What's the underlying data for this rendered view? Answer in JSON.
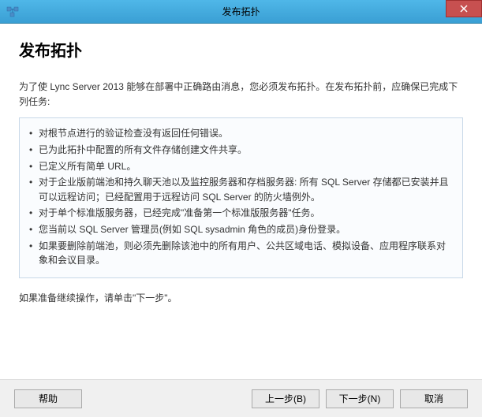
{
  "titlebar": {
    "title": "发布拓扑"
  },
  "page": {
    "title": "发布拓扑",
    "intro": "为了使 Lync Server 2013 能够在部署中正确路由消息，您必须发布拓扑。在发布拓扑前，应确保已完成下列任务:",
    "continue_text": "如果准备继续操作，请单击\"下一步\"。"
  },
  "checklist": [
    "对根节点进行的验证检查没有返回任何错误。",
    "已为此拓扑中配置的所有文件存储创建文件共享。",
    "已定义所有简单 URL。",
    "对于企业版前端池和持久聊天池以及监控服务器和存档服务器: 所有 SQL Server 存储都已安装并且可以远程访问；已经配置用于远程访问 SQL Server 的防火墙例外。",
    "对于单个标准版服务器，已经完成\"准备第一个标准版服务器\"任务。",
    "您当前以 SQL Server 管理员(例如 SQL sysadmin 角色的成员)身份登录。",
    "如果要删除前端池，则必须先删除该池中的所有用户、公共区域电话、模拟设备、应用程序联系对象和会议目录。"
  ],
  "buttons": {
    "help": "帮助",
    "back": "上一步(B)",
    "next": "下一步(N)",
    "cancel": "取消"
  }
}
